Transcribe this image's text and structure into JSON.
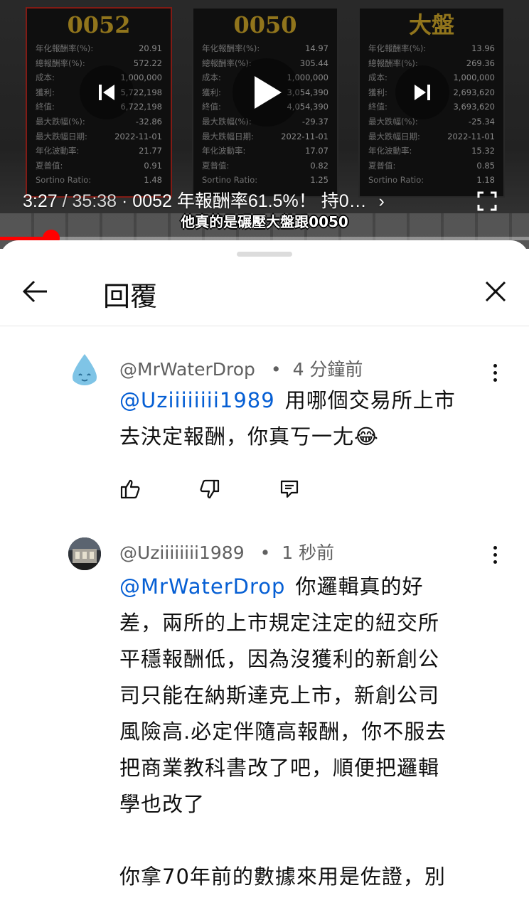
{
  "player": {
    "panels": [
      {
        "title": "0052",
        "highlight": true,
        "rows": [
          {
            "label": "年化報酬率(%):",
            "value": "20.91"
          },
          {
            "label": "總報酬率(%):",
            "value": "572.22"
          },
          {
            "label": "成本:",
            "value": "1,000,000"
          },
          {
            "label": "獲利:",
            "value": "5,722,198"
          },
          {
            "label": "終值:",
            "value": "6,722,198"
          },
          {
            "label": "最大跌幅(%):",
            "value": "-32.86"
          },
          {
            "label": "最大跌幅日期:",
            "value": "2022-11-01"
          },
          {
            "label": "年化波動率:",
            "value": "21.77"
          },
          {
            "label": "夏普值:",
            "value": "0.91"
          },
          {
            "label": "Sortino Ratio:",
            "value": "1.48"
          }
        ]
      },
      {
        "title": "0050",
        "highlight": false,
        "rows": [
          {
            "label": "年化報酬率(%):",
            "value": "14.97"
          },
          {
            "label": "總報酬率(%):",
            "value": "305.44"
          },
          {
            "label": "成本:",
            "value": "1,000,000"
          },
          {
            "label": "獲利:",
            "value": "3,054,390"
          },
          {
            "label": "終值:",
            "value": "4,054,390"
          },
          {
            "label": "最大跌幅(%):",
            "value": "-29.37"
          },
          {
            "label": "最大跌幅日期:",
            "value": "2022-11-01"
          },
          {
            "label": "年化波動率:",
            "value": "17.07"
          },
          {
            "label": "夏普值:",
            "value": "0.82"
          },
          {
            "label": "Sortino Ratio:",
            "value": "1.25"
          }
        ]
      },
      {
        "title": "大盤",
        "highlight": false,
        "rows": [
          {
            "label": "年化報酬率(%):",
            "value": "13.96"
          },
          {
            "label": "總報酬率(%):",
            "value": "269.36"
          },
          {
            "label": "成本:",
            "value": "1,000,000"
          },
          {
            "label": "獲利:",
            "value": "2,693,620"
          },
          {
            "label": "終值:",
            "value": "3,693,620"
          },
          {
            "label": "最大跌幅(%):",
            "value": "-25.34"
          },
          {
            "label": "最大跌幅日期:",
            "value": "2022-11-01"
          },
          {
            "label": "年化波動率:",
            "value": "15.32"
          },
          {
            "label": "夏普值:",
            "value": "0.85"
          },
          {
            "label": "Sortino Ratio:",
            "value": "1.18"
          }
        ]
      }
    ],
    "current_time": "3:27",
    "duration": " / 35:38",
    "chapter": " · 0052 年報酬率61.5%！ 持0…",
    "chapter_chevron": "›",
    "subtitle": "他真的是碾壓大盤跟0050",
    "progress_fraction": 0.097,
    "accent": "#ff0000"
  },
  "header": {
    "title": "回覆",
    "back_icon": "arrow-left-icon",
    "close_icon": "close-icon"
  },
  "comments": [
    {
      "author": "@MrWaterDrop",
      "time": "4 分鐘前",
      "mention": "@Uziiiiiiii1989",
      "text": "用哪個交易所上市去決定報酬，你真丂一尢😂",
      "avatar_icon": "water-drop-icon"
    },
    {
      "author": "@Uziiiiiiii1989",
      "time": "1 秒前",
      "mention": "@MrWaterDrop",
      "line1": "你邏輯真的好",
      "lines": [
        "差，兩所的上市規定注定的紐交所",
        "平穩報酬低，因為沒獲利的新創公",
        "司只能在納斯達克上市，新創公司",
        "風險高.必定伴隨高報酬，你不服去",
        "把商業教科書改了吧，順便把邏輯",
        "學也改了"
      ],
      "line_after": "你拿70年前的數據來用是佐證，別",
      "avatar_icon": "photo-avatar-icon"
    }
  ],
  "separator": "•"
}
